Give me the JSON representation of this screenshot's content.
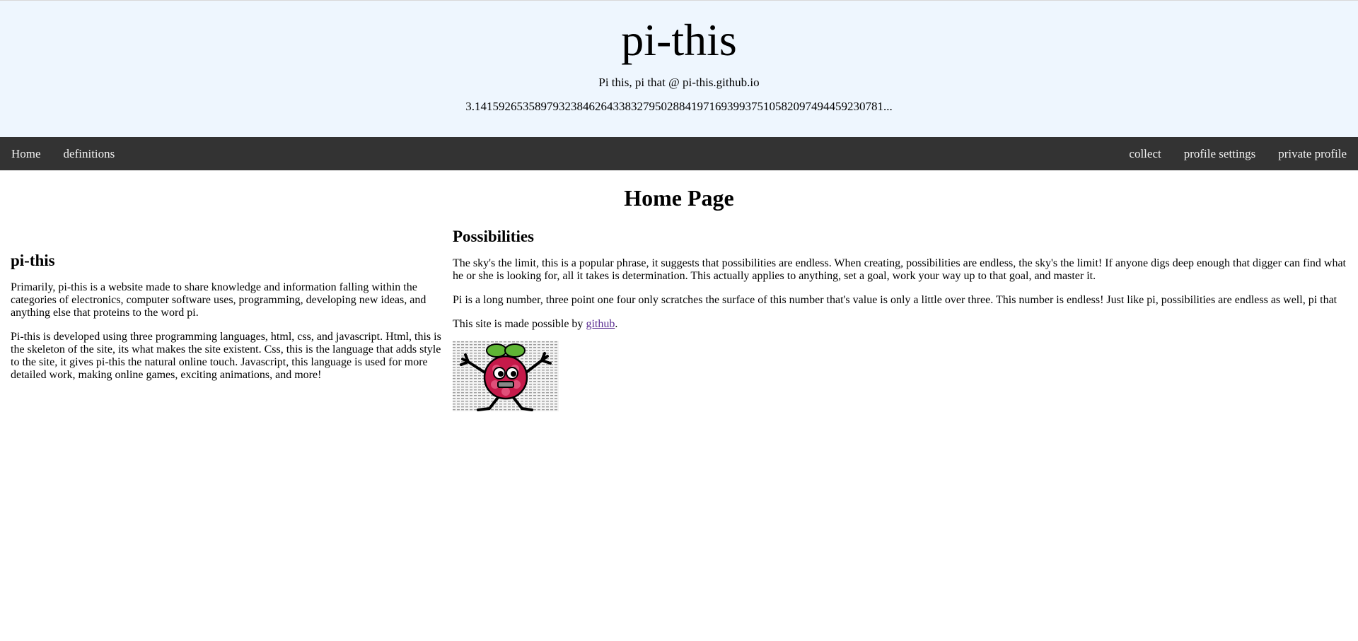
{
  "header": {
    "title": "pi-this",
    "tagline": "Pi this, pi that @ pi-this.github.io",
    "pi_digits": "3.14159265358979323846264338327950288419716939937510582097494459230781..."
  },
  "nav": {
    "left": [
      "Home",
      "definitions"
    ],
    "right": [
      "collect",
      "profile settings",
      "private profile"
    ]
  },
  "main": {
    "page_title": "Home Page",
    "left": {
      "heading": "pi-this",
      "paragraphs": [
        "Primarily, pi-this is a website made to share knowledge and information falling within the categories of electronics, computer software uses, programming, developing new ideas, and anything else that proteins to the word pi.",
        "Pi-this is developed using three programming languages, html, css, and javascript. Html, this is the skeleton of the site, its what makes the site existent. Css, this is the language that adds style to the site, it gives pi-this the natural online touch. Javascript, this language is used for more detailed work, making online games, exciting animations, and more!"
      ]
    },
    "right": {
      "heading": "Possibilities",
      "paragraphs": [
        "The sky's the limit, this is a popular phrase, it suggests that possibilities are endless. When creating, possibilities are endless, the sky's the limit! If anyone digs deep enough that digger can find what he or she is looking for, all it takes is determination. This actually applies to anything, set a goal, work your way up to that goal, and master it.",
        "Pi is a long number, three point one four only scratches the surface of this number that's value is only a little over three. This number is endless! Just like pi, possibilities are endless as well, pi that"
      ],
      "credit_prefix": "This site is made possible by ",
      "credit_link": "github",
      "credit_suffix": ".",
      "image_icon": "raspberry-pi-mascot-icon"
    }
  },
  "colors": {
    "header_bg": "#eef6fe",
    "nav_bg": "#333333",
    "nav_text": "#f2f2f2",
    "link": "#5a2c91"
  }
}
